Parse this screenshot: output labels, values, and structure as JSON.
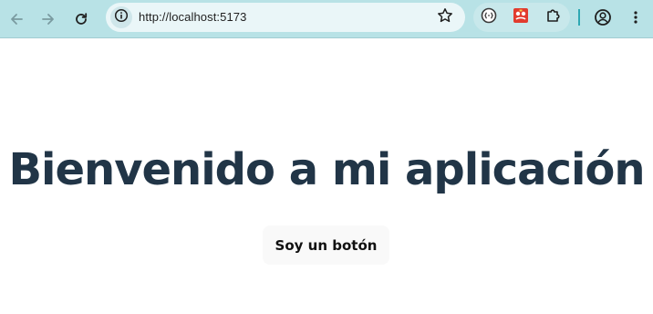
{
  "browser": {
    "url": "http://localhost:5173",
    "icons": {
      "back": "arrow-left-icon",
      "forward": "arrow-right-icon",
      "reload": "reload-icon",
      "site_info": "info-icon",
      "bookmark": "star-icon",
      "extension_1": "tab-resize-extension-icon",
      "extension_2": "red-extension-icon",
      "extensions_menu": "puzzle-icon",
      "profile": "profile-icon",
      "menu": "kebab-menu-icon"
    },
    "colors": {
      "toolbar_bg": "#b8e2e6",
      "omnibox_bg": "#eaf6f8",
      "divider": "#2ea8b3"
    }
  },
  "page": {
    "title": "Bienvenido a mi aplicación",
    "button_label": "Soy un botón",
    "colors": {
      "title": "#213547",
      "button_bg": "#f9f9f9"
    }
  }
}
